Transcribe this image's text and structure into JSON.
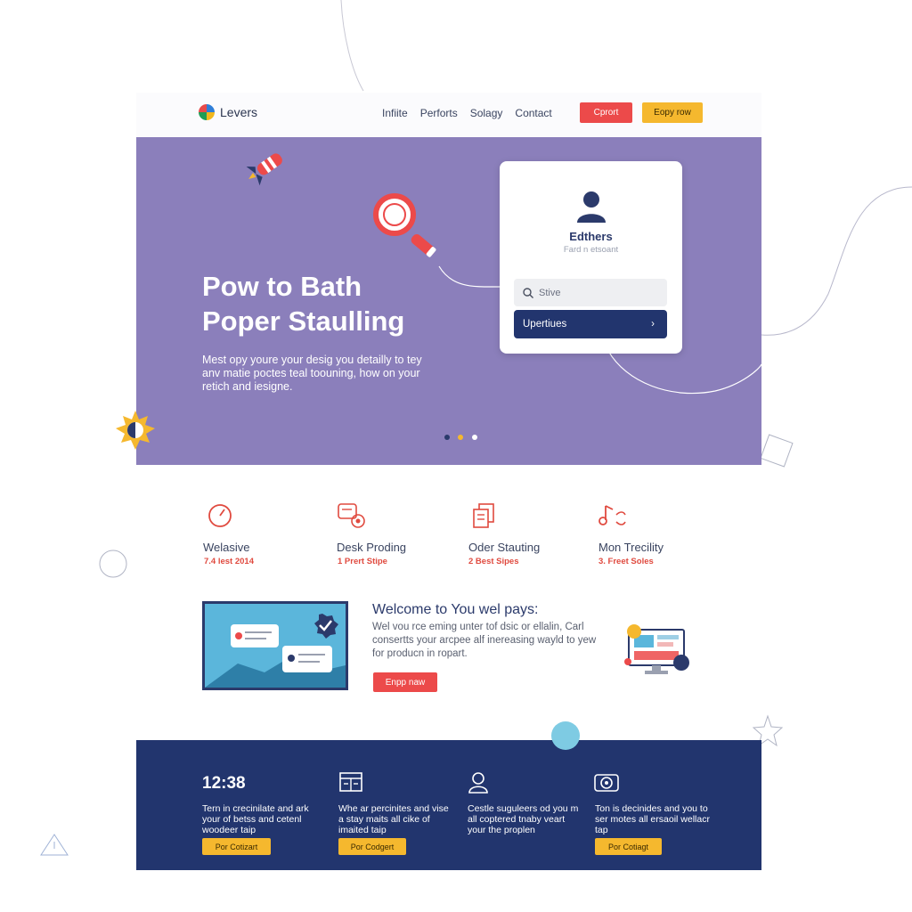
{
  "header": {
    "brand": "Levers",
    "nav": [
      "Infiite",
      "Perforts",
      "Solagy",
      "Contact"
    ],
    "btn_primary": "Cprort",
    "btn_secondary": "Eopy row"
  },
  "hero": {
    "title_line1": "Pow to Bath",
    "title_line2": "Poper Staulling",
    "description": "Mest opy youre your desig you detailly to tey anv matie poctes teal toouning, how on your retich and iesigne.",
    "card": {
      "name": "Edthers",
      "subtitle": "Fard n etsoant",
      "search_placeholder": "Stive",
      "button_label": "Upertiues"
    },
    "carousel_dots": [
      "#2b3a6b",
      "#f5b82e",
      "#ffffff"
    ]
  },
  "features": [
    {
      "title": "Welasive",
      "subtitle": "7.4 lest 2014",
      "icon": "gauge-icon"
    },
    {
      "title": "Desk Proding",
      "subtitle": "1 Prert Stipe",
      "icon": "chat-badge-icon"
    },
    {
      "title": "Oder Stauting",
      "subtitle": "2 Best Sipes",
      "icon": "documents-icon"
    },
    {
      "title": "Mon Trecility",
      "subtitle": "3. Freet Soles",
      "icon": "music-note-icon"
    }
  ],
  "welcome": {
    "title": "Welcome to You wel pays:",
    "text": "Wel vou rce eming unter tof dsic or ellalin, Carl consertts your arcpee alf inereasing wayld to yew for producn in ropart.",
    "button": "Enpp naw"
  },
  "footer": {
    "columns": [
      {
        "heading": "12:38",
        "icon": "",
        "text": "Tern in crecinilate and ark your of betss and cetenl woodeer taip",
        "button": "Por Cotizart"
      },
      {
        "heading": "",
        "icon": "calendar-icon",
        "text": "Whe ar percinites and vise a stay maits all cike of imaited taip",
        "button": "Por Codgert"
      },
      {
        "heading": "",
        "icon": "user-icon",
        "text": "Cestle suguleers od you m all coptered tnaby veart your the proplen",
        "button": ""
      },
      {
        "heading": "",
        "icon": "camera-icon",
        "text": "Ton is decinides and you to ser motes all ersaoil wellacr tap",
        "button": "Por Cotiagt"
      }
    ]
  },
  "colors": {
    "hero_bg": "#8b7fbb",
    "navy": "#22356e",
    "accent_red": "#ec4a4a",
    "accent_yellow": "#f5b82e"
  }
}
